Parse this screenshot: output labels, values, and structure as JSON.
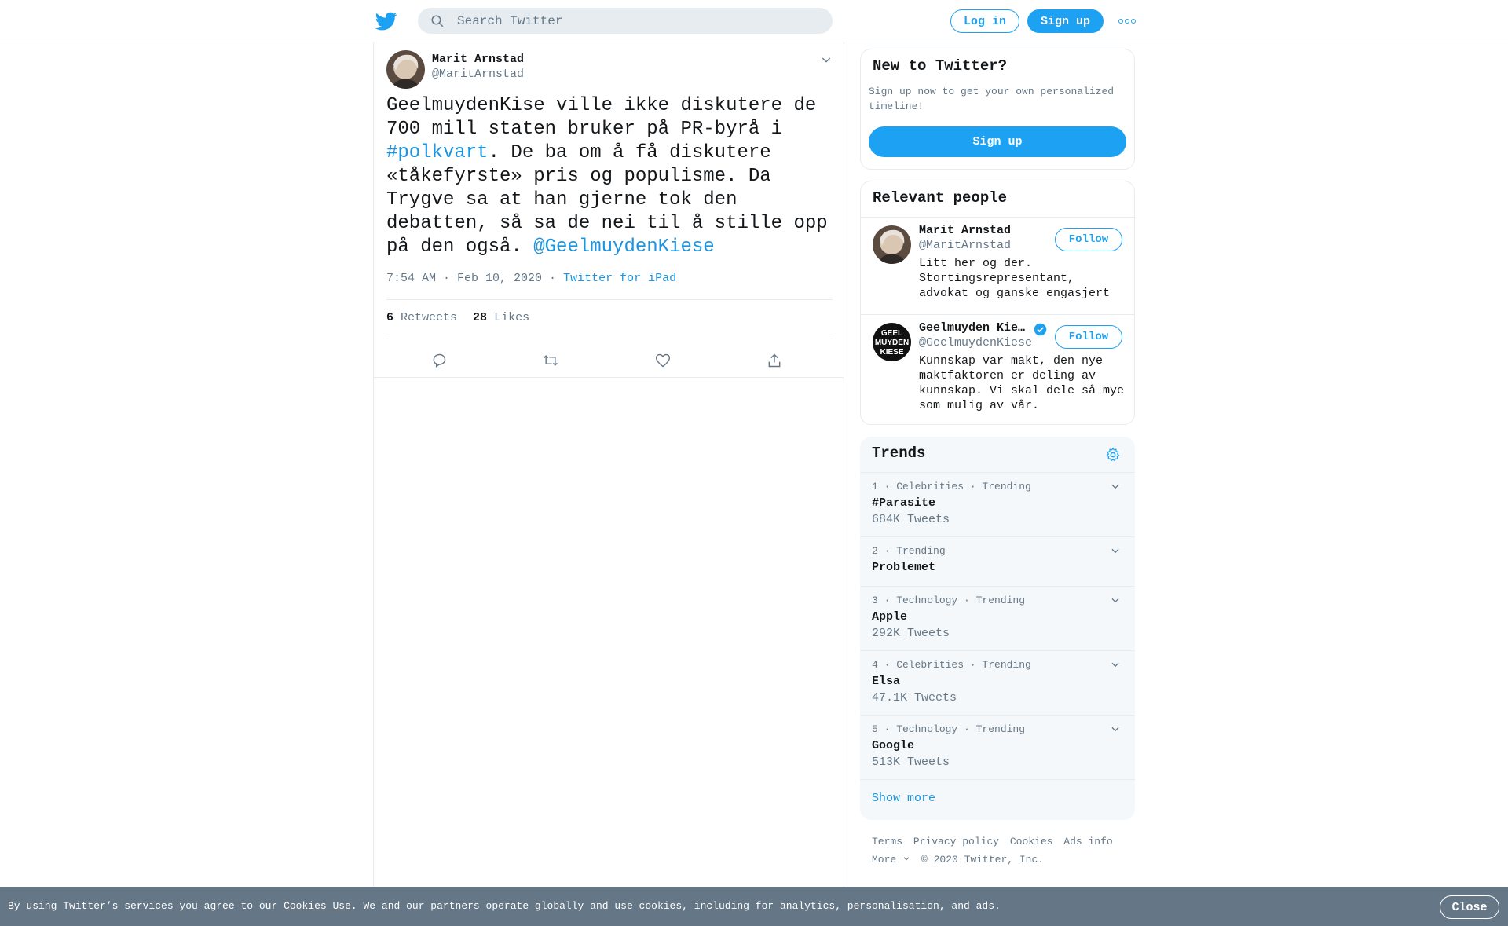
{
  "header": {
    "search_placeholder": "Search Twitter",
    "login_label": "Log in",
    "signup_label": "Sign up"
  },
  "tweet": {
    "author_name": "Marit Arnstad",
    "author_handle": "@MaritArnstad",
    "text_part1": "GeelmuydenKise ville ikke diskutere de 700 mill staten bruker på PR-byrå i ",
    "hashtag": "#polkvart",
    "text_part2": ". De ba om å få diskutere «tåkefyrste» pris og populisme. Da Trygve sa at han gjerne tok den debatten, så sa de nei til å stille opp på den også. ",
    "mention": "@GeelmuydenKiese",
    "timestamp": "7:54 AM · Feb 10, 2020",
    "separator": " · ",
    "source": "Twitter for iPad",
    "retweets_count": "6",
    "retweets_label": "Retweets",
    "likes_count": "28",
    "likes_label": "Likes"
  },
  "new_to_twitter": {
    "title": "New to Twitter?",
    "description": "Sign up now to get your own personalized timeline!",
    "signup_label": "Sign up"
  },
  "relevant_people": {
    "title": "Relevant people",
    "people": [
      {
        "name": "Marit Arnstad",
        "handle": "@MaritArnstad",
        "bio": "Litt her og der. Stortingsrepresentant, advokat og ganske engasjert",
        "follow_label": "Follow"
      },
      {
        "name": "Geelmuyden Kiese",
        "handle": "@GeelmuydenKiese",
        "bio": "Kunnskap var makt, den nye maktfaktoren er deling av kunnskap. Vi skal dele så mye som mulig av vår.",
        "follow_label": "Follow",
        "avatar_text": "GEEL MUYDEN KIESE"
      }
    ]
  },
  "trends": {
    "title": "Trends",
    "items": [
      {
        "meta": "1 · Celebrities · Trending",
        "name": "#Parasite",
        "count": "684K Tweets"
      },
      {
        "meta": "2 · Trending",
        "name": "Problemet",
        "count": ""
      },
      {
        "meta": "3 · Technology · Trending",
        "name": "Apple",
        "count": "292K Tweets"
      },
      {
        "meta": "4 · Celebrities · Trending",
        "name": "Elsa",
        "count": "47.1K Tweets"
      },
      {
        "meta": "5 · Technology · Trending",
        "name": "Google",
        "count": "513K Tweets"
      }
    ],
    "show_more": "Show more"
  },
  "footer": {
    "terms": "Terms",
    "privacy": "Privacy policy",
    "cookies": "Cookies",
    "ads": "Ads info",
    "more": "More",
    "copyright": "© 2020 Twitter, Inc."
  },
  "cookie_bar": {
    "text_before": "By using Twitter’s services you agree to our ",
    "link": "Cookies Use",
    "text_after": ". We and our partners operate globally and use cookies, including for analytics, personalisation, and ads.",
    "close_label": "Close"
  },
  "colors": {
    "accent": "#1da1f2",
    "link": "#1b95e0",
    "secondary_text": "#657786",
    "cookie_bar_bg": "#657786"
  }
}
